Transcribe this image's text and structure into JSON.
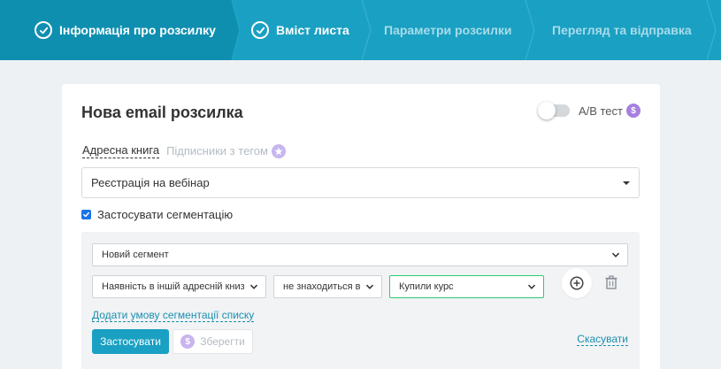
{
  "steps": [
    {
      "label": "Інформація про розсилку",
      "state": "done"
    },
    {
      "label": "Вміст листа",
      "state": "done"
    },
    {
      "label": "Параметри розсилки",
      "state": "todo"
    },
    {
      "label": "Перегляд та відправка",
      "state": "todo"
    }
  ],
  "colors": {
    "accent": "#1aa0c2",
    "accent_dark": "#0f8fb0",
    "success": "#2ecc71",
    "premium": "#a77fe0"
  },
  "card": {
    "title": "Нова email розсилка",
    "ab_test_label": "A/B тест",
    "ab_test_enabled": false,
    "premium_symbol": "$"
  },
  "source_tabs": {
    "address_book": "Адресна книга",
    "subscribers_by_tag": "Підписники з тегом"
  },
  "address_book_select": {
    "value": "Реєстрація на вебінар"
  },
  "segmentation": {
    "checkbox_label": "Застосувати сегментацію",
    "checked": true,
    "segment_select": "Новий сегмент",
    "condition": {
      "field": "Наявність в іншій адресній книзі",
      "operator": "не знаходиться в",
      "value": "Купили курс"
    },
    "add_condition_link": "Додати умову сегментації списку",
    "apply_button": "Застосувати",
    "save_button": "Зберегти",
    "cancel_link": "Скасувати"
  },
  "icons": [
    "check-circle-icon",
    "toggle-switch",
    "dollar-coin-icon",
    "star-badge-icon",
    "caret-down-icon",
    "chevron-down-icon",
    "plus-circle-icon",
    "trash-icon",
    "checkbox-checked-icon"
  ]
}
